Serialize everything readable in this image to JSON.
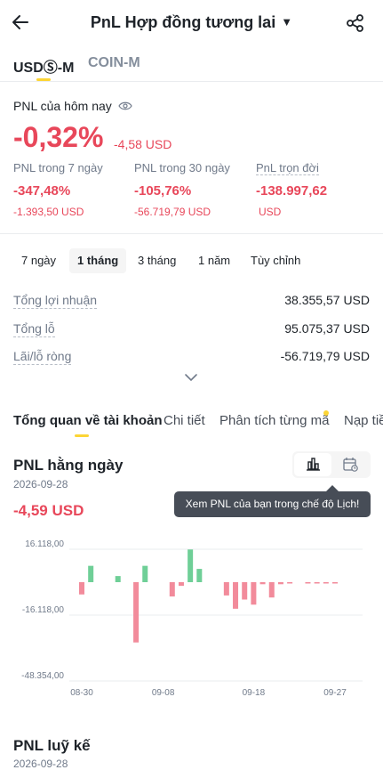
{
  "header": {
    "title": "PnL Hợp đồng tương lai",
    "tabs": [
      {
        "label": "USDⓈ-M",
        "active": true
      },
      {
        "label": "COIN-M",
        "active": false
      }
    ]
  },
  "today": {
    "label": "PNL của hôm nay",
    "pct": "-0,32%",
    "usd": "-4,58 USD"
  },
  "stats": [
    {
      "label": "PNL trong 7 ngày",
      "value": "-347,48%",
      "sub": "-1.393,50 USD"
    },
    {
      "label": "PNL trong 30 ngày",
      "value": "-105,76%",
      "sub": "-56.719,79 USD"
    },
    {
      "label": "PnL trọn đời",
      "value": "-138.997,62",
      "sub": "USD"
    }
  ],
  "periods": [
    {
      "label": "7 ngày",
      "active": false
    },
    {
      "label": "1 tháng",
      "active": true
    },
    {
      "label": "3 tháng",
      "active": false
    },
    {
      "label": "1 năm",
      "active": false
    },
    {
      "label": "Tùy chỉnh",
      "active": false
    }
  ],
  "summary": [
    {
      "label": "Tổng lợi nhuận",
      "value": "38.355,57 USD"
    },
    {
      "label": "Tổng lỗ",
      "value": "95.075,37 USD"
    },
    {
      "label": "Lãi/lỗ ròng",
      "value": "-56.719,79 USD"
    }
  ],
  "subtabs": [
    {
      "label": "Tổng quan về tài khoản",
      "active": true
    },
    {
      "label": "Chi tiết",
      "active": false
    },
    {
      "label": "Phân tích từng mã",
      "active": false
    },
    {
      "label": "Nạp tiền",
      "active": false
    }
  ],
  "daily": {
    "title": "PNL hằng ngày",
    "date": "2026-09-28",
    "value": "-4,59 USD",
    "tooltip": "Xem PNL của bạn trong chế độ Lịch!"
  },
  "cumulative": {
    "title": "PNL luỹ kế",
    "date": "2026-09-28"
  },
  "colors": {
    "positive": "#6fcf97",
    "negative": "#f28b9b",
    "accent": "#fcd535",
    "down_text": "#e8475a"
  },
  "chart_data": {
    "type": "bar",
    "y_ticks": [
      "16.118,00",
      "-16.118,00",
      "-48.354,00"
    ],
    "y_tick_values": [
      16118,
      -16118,
      -48354
    ],
    "x_tick_labels": [
      "08-30",
      "09-08",
      "09-18",
      "09-27"
    ],
    "x_tick_days": [
      1,
      10,
      20,
      29
    ],
    "ylim": [
      -48354,
      16118
    ],
    "grid": true,
    "days": [
      1,
      2,
      3,
      4,
      5,
      6,
      7,
      8,
      9,
      10,
      11,
      12,
      13,
      14,
      15,
      16,
      17,
      18,
      19,
      20,
      21,
      22,
      23,
      24,
      25,
      26,
      27,
      28,
      29,
      30
    ],
    "values": [
      -6000,
      8000,
      0,
      0,
      3000,
      0,
      -29500,
      8000,
      0,
      0,
      -7000,
      -1800,
      16000,
      6500,
      0,
      0,
      -6500,
      -13000,
      -8500,
      -11000,
      -1000,
      -7500,
      -1000,
      -400,
      0,
      -400,
      -300,
      -400,
      -300,
      0
    ]
  }
}
